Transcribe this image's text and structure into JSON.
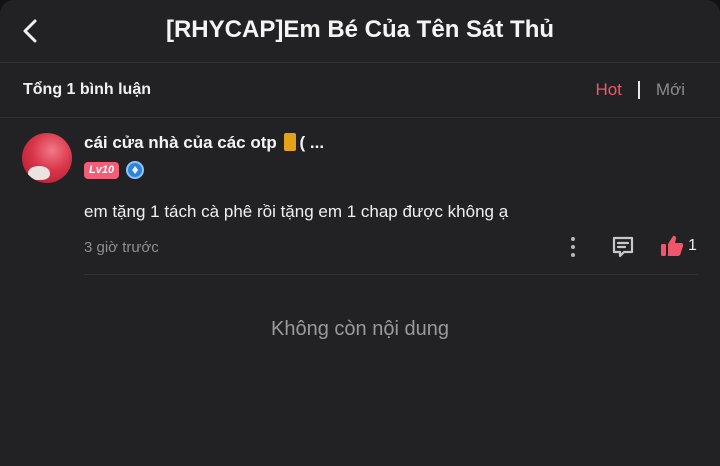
{
  "header": {
    "title": "[RHYCAP]Em Bé Của Tên Sát Thủ",
    "back_icon": "chevron-left-icon"
  },
  "comments_bar": {
    "total_label": "Tổng 1 bình luận",
    "sort_hot": "Hot",
    "sort_new": "Mới",
    "active_sort_color": "#f0556a"
  },
  "comments": [
    {
      "username": "cái cửa nhà của các otp",
      "username_suffix": "( ...",
      "level_badge": "Lv10",
      "verified_icon": "verified-badge-icon",
      "text": "em tặng 1 tách cà phê rồi tặng em 1 chap được không ạ",
      "time": "3 giờ trước",
      "likes": "1",
      "like_color": "#f0556a"
    }
  ],
  "empty_state": "Không còn nội dung"
}
